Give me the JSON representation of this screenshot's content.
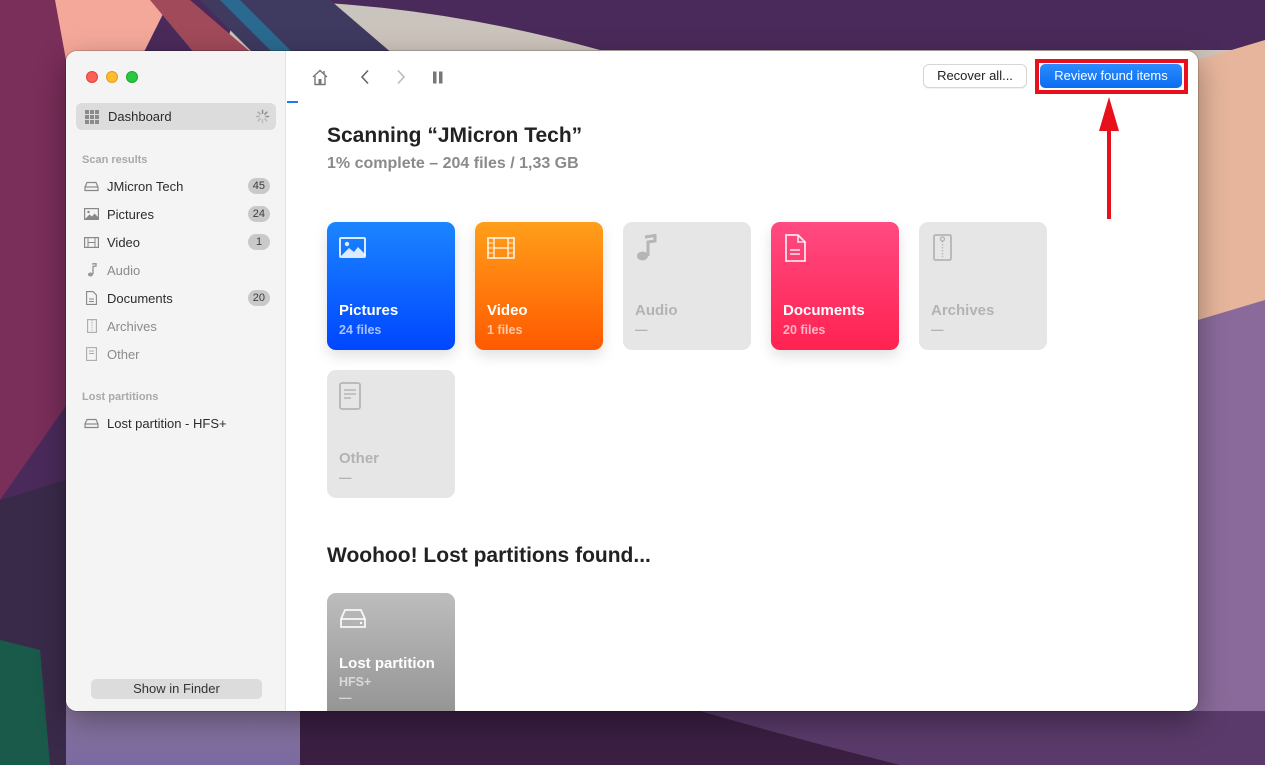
{
  "window": {
    "traffic_lights": [
      "close",
      "minimize",
      "maximize"
    ]
  },
  "sidebar": {
    "dashboard": {
      "label": "Dashboard",
      "icon": "grid-icon",
      "status_icon": "spinner-icon"
    },
    "scan_results_label": "Scan results",
    "items": [
      {
        "label": "JMicron Tech",
        "icon": "drive-icon",
        "badge": "45",
        "dim": false
      },
      {
        "label": "Pictures",
        "icon": "picture-icon",
        "badge": "24",
        "dim": false
      },
      {
        "label": "Video",
        "icon": "film-icon",
        "badge": "1",
        "dim": false
      },
      {
        "label": "Audio",
        "icon": "music-note-icon",
        "badge": null,
        "dim": true
      },
      {
        "label": "Documents",
        "icon": "document-icon",
        "badge": "20",
        "dim": false
      },
      {
        "label": "Archives",
        "icon": "archive-icon",
        "badge": null,
        "dim": true
      },
      {
        "label": "Other",
        "icon": "other-file-icon",
        "badge": null,
        "dim": true
      }
    ],
    "lost_partitions_label": "Lost partitions",
    "lost_partitions": [
      {
        "label": "Lost partition - HFS+",
        "icon": "drive-icon"
      }
    ],
    "show_in_finder_label": "Show in Finder"
  },
  "toolbar": {
    "home_icon": "home-icon",
    "back_icon": "chevron-left-icon",
    "forward_icon": "chevron-right-icon",
    "pause_icon": "pause-icon",
    "recover_all_label": "Recover all...",
    "review_label": "Review found items"
  },
  "main": {
    "title": "Scanning “JMicron Tech”",
    "subtitle": "1% complete – 204 files / 1,33 GB",
    "progress_percent": 1,
    "categories": [
      {
        "name": "Pictures",
        "count": "24 files",
        "active": true,
        "color": "#0a5cff"
      },
      {
        "name": "Video",
        "count": "1 files",
        "active": true,
        "color": "#ff7a0a"
      },
      {
        "name": "Audio",
        "count": "—",
        "active": false,
        "color": "#e6e6e6"
      },
      {
        "name": "Documents",
        "count": "20 files",
        "active": true,
        "color": "#ff3366"
      },
      {
        "name": "Archives",
        "count": "—",
        "active": false,
        "color": "#e6e6e6"
      },
      {
        "name": "Other",
        "count": "—",
        "active": false,
        "color": "#e6e6e6"
      }
    ],
    "lost_section_title": "Woohoo! Lost partitions found...",
    "lost_partition_card": {
      "name": "Lost partition",
      "fs": "HFS+",
      "count": "—"
    }
  },
  "annotation": {
    "highlight_color": "#e8101a",
    "target": "Review found items"
  }
}
